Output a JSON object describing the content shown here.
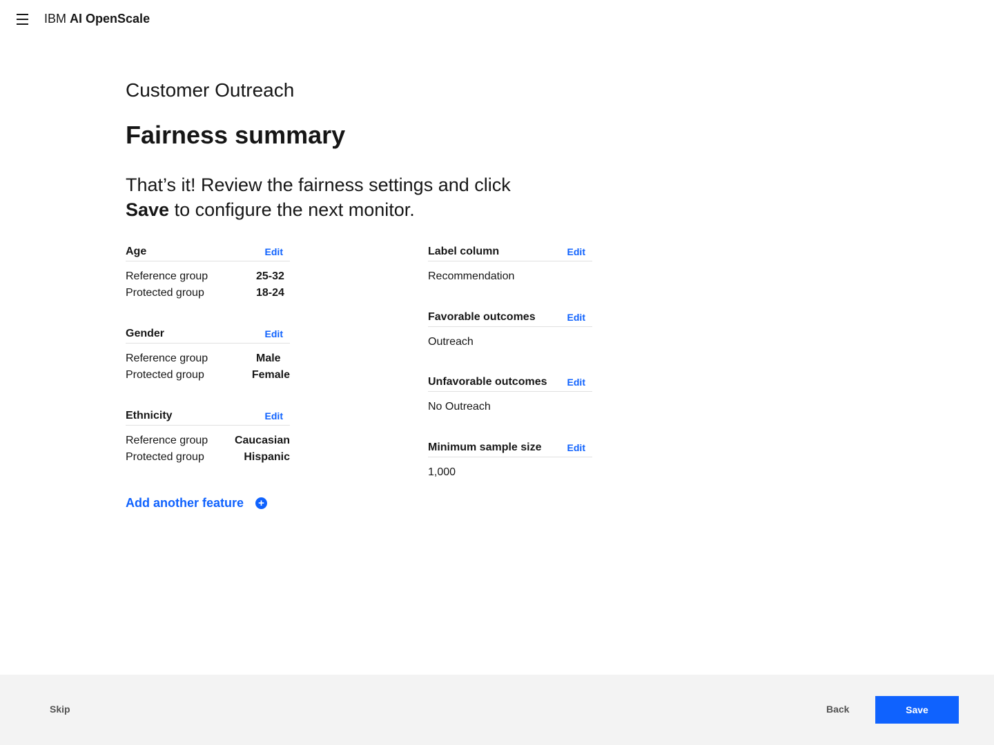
{
  "header": {
    "brand_prefix": "IBM",
    "brand_name": "AI OpenScale"
  },
  "project": "Customer Outreach",
  "title": "Fairness summary",
  "intro": {
    "line1": "That’s it! Review the fairness settings and click",
    "save_word": "Save",
    "line2_rest": " to configure the next monitor."
  },
  "edit_label": "Edit",
  "features": [
    {
      "name": "Age",
      "rows": [
        {
          "k": "Reference group",
          "v": "25-32"
        },
        {
          "k": "Protected group",
          "v": "18-24"
        }
      ]
    },
    {
      "name": "Gender",
      "rows": [
        {
          "k": "Reference group",
          "v": "Male"
        },
        {
          "k": "Protected group",
          "v": "Female"
        }
      ]
    },
    {
      "name": "Ethnicity",
      "rows": [
        {
          "k": "Reference group",
          "v": "Caucasian"
        },
        {
          "k": "Protected group",
          "v": "Hispanic"
        }
      ]
    }
  ],
  "settings": [
    {
      "name": "Label column",
      "value": "Recommendation"
    },
    {
      "name": "Favorable outcomes",
      "value": "Outreach"
    },
    {
      "name": "Unfavorable outcomes",
      "value": "No Outreach"
    },
    {
      "name": "Minimum sample size",
      "value": "1,000"
    }
  ],
  "add_feature": "Add another feature",
  "footer": {
    "skip": "Skip",
    "back": "Back",
    "save": "Save"
  }
}
